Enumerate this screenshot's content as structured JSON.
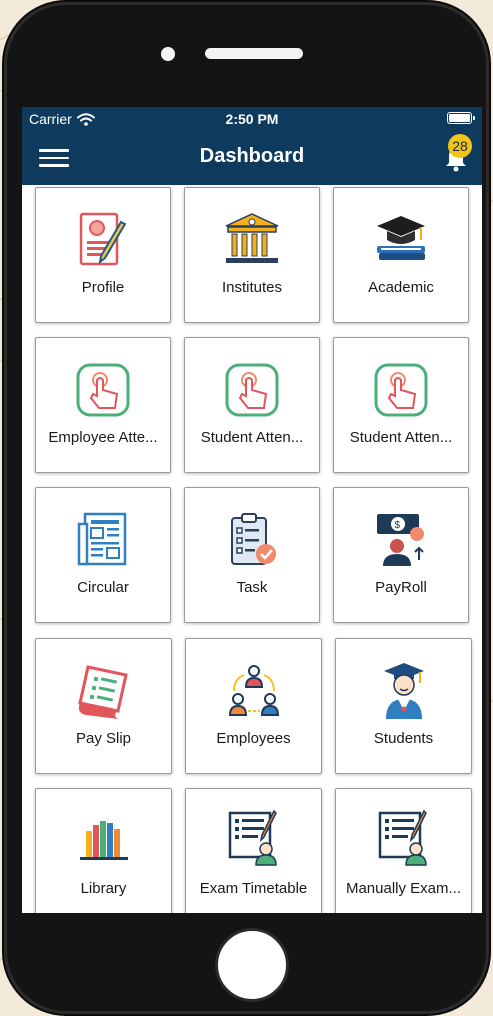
{
  "statusbar": {
    "carrier": "Carrier",
    "time": "2:50 PM"
  },
  "navbar": {
    "title": "Dashboard",
    "notification_count": "28"
  },
  "colors": {
    "header": "#0e3a5e",
    "badge": "#f0c419"
  },
  "tiles": [
    {
      "label": "Profile",
      "icon": "profile-icon"
    },
    {
      "label": "Institutes",
      "icon": "institute-icon"
    },
    {
      "label": "Academic",
      "icon": "academic-icon"
    },
    {
      "label": "Employee Atte...",
      "icon": "employee-attendance-icon"
    },
    {
      "label": "Student Atten...",
      "icon": "student-attendance-icon"
    },
    {
      "label": "Student Atten...",
      "icon": "student-attendance-icon"
    },
    {
      "label": "Circular",
      "icon": "circular-icon"
    },
    {
      "label": "Task",
      "icon": "task-icon"
    },
    {
      "label": "PayRoll",
      "icon": "payroll-icon"
    },
    {
      "label": "Pay Slip",
      "icon": "pay-slip-icon"
    },
    {
      "label": "Employees",
      "icon": "employees-icon"
    },
    {
      "label": "Students",
      "icon": "students-icon"
    },
    {
      "label": "Library",
      "icon": "library-icon"
    },
    {
      "label": "Exam Timetable",
      "icon": "exam-timetable-icon"
    },
    {
      "label": "Manually Exam...",
      "icon": "manual-exam-icon"
    }
  ]
}
